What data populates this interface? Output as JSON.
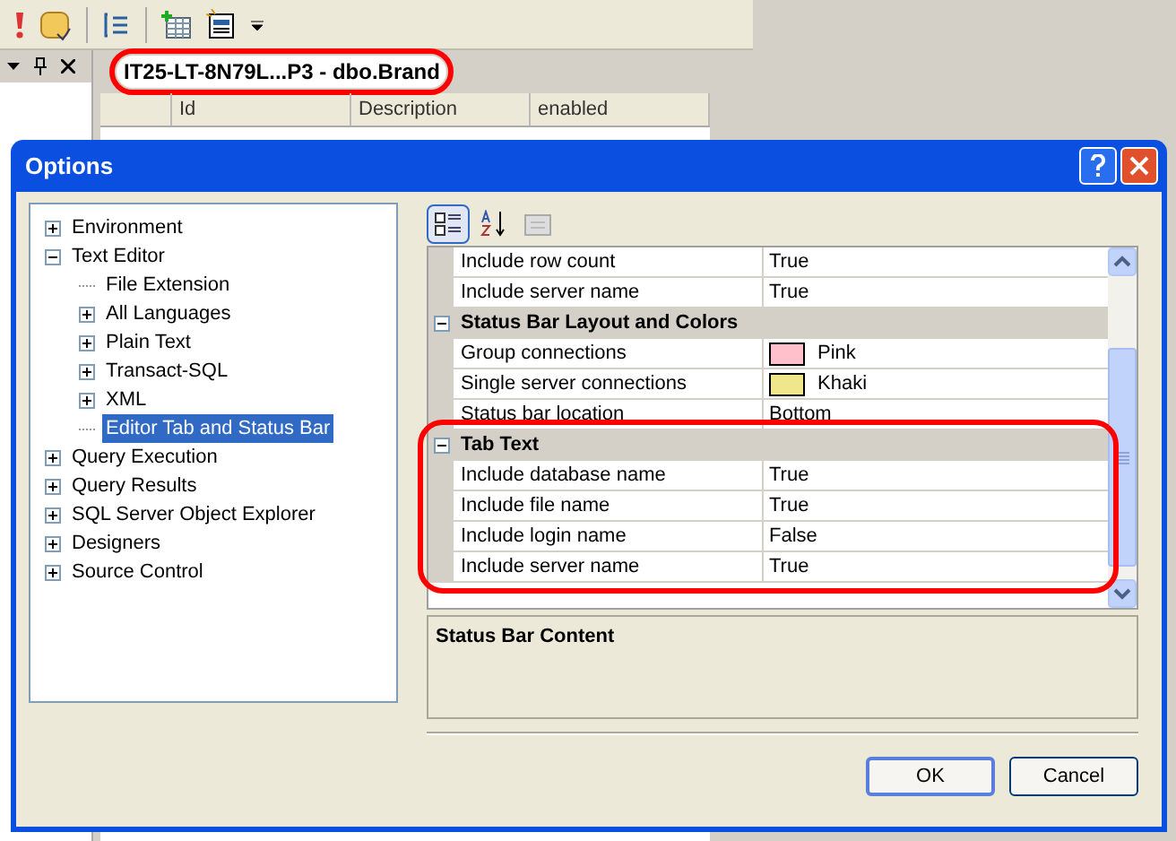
{
  "document_tab": {
    "title": "IT25-LT-8N79L...P3 - dbo.Brand",
    "highlighted": true
  },
  "grid": {
    "columns": [
      "Id",
      "Description",
      "enabled"
    ]
  },
  "dialog": {
    "title": "Options",
    "tree": [
      {
        "label": "Environment",
        "expandable": true,
        "expanded": false,
        "selected": false
      },
      {
        "label": "Text Editor",
        "expandable": true,
        "expanded": true,
        "selected": false,
        "children": [
          {
            "label": "File Extension",
            "expandable": false,
            "selected": false
          },
          {
            "label": "All Languages",
            "expandable": true,
            "expanded": false,
            "selected": false
          },
          {
            "label": "Plain Text",
            "expandable": true,
            "expanded": false,
            "selected": false
          },
          {
            "label": "Transact-SQL",
            "expandable": true,
            "expanded": false,
            "selected": false
          },
          {
            "label": "XML",
            "expandable": true,
            "expanded": false,
            "selected": false
          },
          {
            "label": "Editor Tab and Status Bar",
            "expandable": false,
            "selected": true
          }
        ]
      },
      {
        "label": "Query Execution",
        "expandable": true,
        "expanded": false,
        "selected": false
      },
      {
        "label": "Query Results",
        "expandable": true,
        "expanded": false,
        "selected": false
      },
      {
        "label": "SQL Server Object Explorer",
        "expandable": true,
        "expanded": false,
        "selected": false
      },
      {
        "label": "Designers",
        "expandable": true,
        "expanded": false,
        "selected": false
      },
      {
        "label": "Source Control",
        "expandable": true,
        "expanded": false,
        "selected": false
      }
    ],
    "toolbar": [
      {
        "kind": "categorized",
        "selected": true
      },
      {
        "kind": "alphabetical",
        "selected": false
      },
      {
        "kind": "pages",
        "selected": false
      }
    ],
    "properties": [
      {
        "kind": "property",
        "name": "Include row count",
        "value": "True"
      },
      {
        "kind": "property",
        "name": "Include server name",
        "value": "True"
      },
      {
        "kind": "category",
        "name": "Status Bar Layout and Colors",
        "expanded": true,
        "highlighted": false
      },
      {
        "kind": "property",
        "name": "Group connections",
        "value": "Pink",
        "color": "#ffc0cb"
      },
      {
        "kind": "property",
        "name": "Single server connections",
        "value": "Khaki",
        "color": "#f0e68c"
      },
      {
        "kind": "property",
        "name": "Status bar location",
        "value": "Bottom"
      },
      {
        "kind": "category",
        "name": "Tab Text",
        "expanded": true,
        "highlighted": true
      },
      {
        "kind": "property",
        "name": "Include database name",
        "value": "True"
      },
      {
        "kind": "property",
        "name": "Include file name",
        "value": "True"
      },
      {
        "kind": "property",
        "name": "Include login name",
        "value": "False"
      },
      {
        "kind": "property",
        "name": "Include server name",
        "value": "True"
      }
    ],
    "description": "Status Bar Content",
    "buttons": [
      {
        "label": "OK",
        "default": true
      },
      {
        "label": "Cancel",
        "default": false
      }
    ]
  }
}
